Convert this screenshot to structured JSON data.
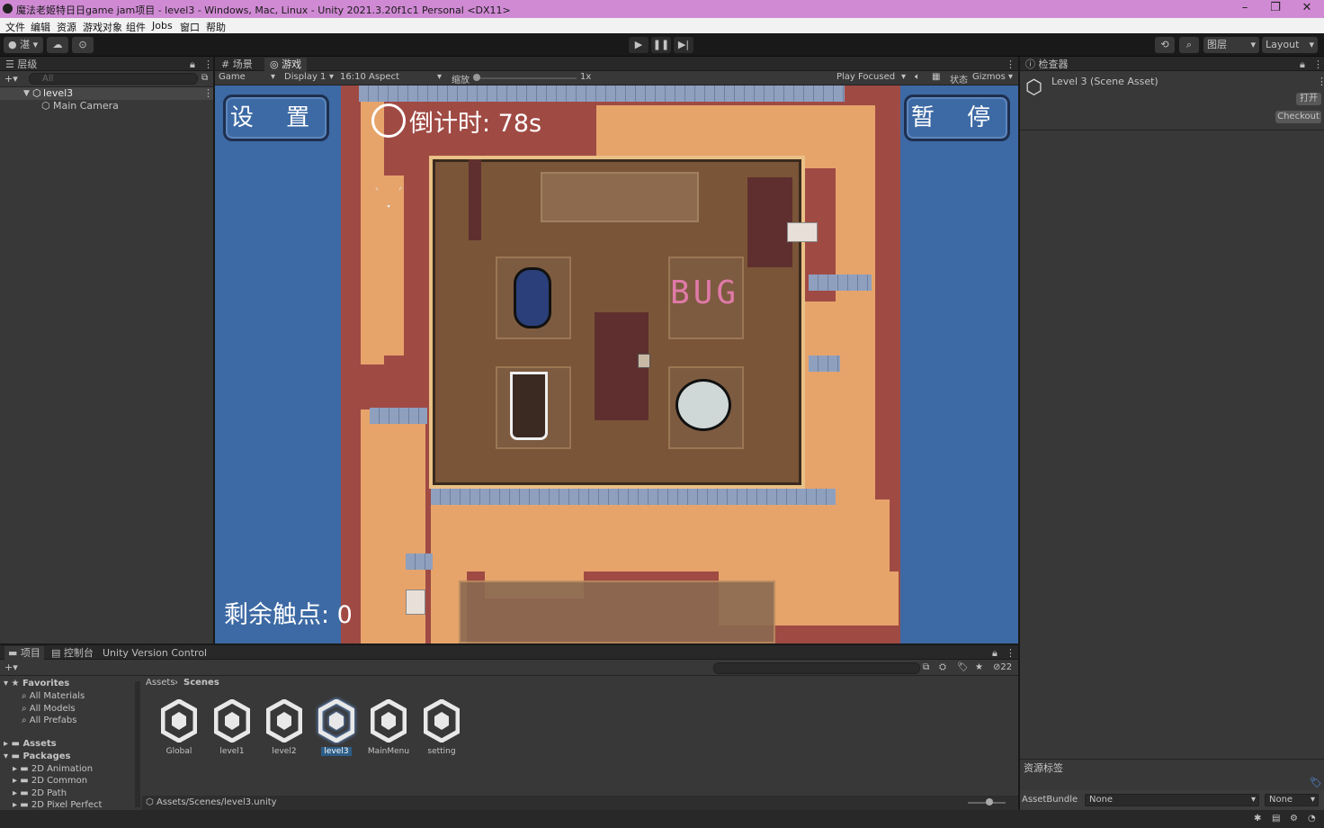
{
  "window": {
    "title": "魔法老姬特日日game jam项目 - level3 - Windows, Mac, Linux - Unity 2021.3.20f1c1 Personal <DX11>"
  },
  "menu": [
    "文件",
    "编辑",
    "资源",
    "游戏对象",
    "组件",
    "Jobs",
    "窗口",
    "帮助"
  ],
  "toolbar": {
    "account_label": "湛",
    "layers_label": "图层",
    "layout_label": "Layout"
  },
  "hierarchy": {
    "tab": "层级",
    "search_placeholder": "All",
    "scene": "level3",
    "items": [
      "Main Camera"
    ]
  },
  "game_tabs": {
    "scene": "场景",
    "game": "游戏"
  },
  "game_toolbar": {
    "mode": "Game",
    "display": "Display 1",
    "aspect": "16:10 Aspect",
    "scale_label": "缩放",
    "scale_value": "1x",
    "play_mode": "Play Focused",
    "stats": "状态",
    "gizmos": "Gizmos"
  },
  "game_ui": {
    "settings_button": "设 置",
    "timer_label": "倒计时: 78s",
    "pause_button": "暂 停",
    "remaining_label": "剩余触点: 0",
    "bug_text": "BUG"
  },
  "inspector": {
    "tab": "检查器",
    "asset_title": "Level 3 (Scene Asset)",
    "open_button": "打开",
    "checkout_button": "Checkout",
    "labels_title": "资源标签",
    "assetbundle_label": "AssetBundle",
    "assetbundle_value": "None",
    "variant_value": "None"
  },
  "project": {
    "tabs": [
      "项目",
      "控制台",
      "Unity Version Control"
    ],
    "hidden_count": "22",
    "breadcrumb": [
      "Assets",
      "Scenes"
    ],
    "favorites_title": "Favorites",
    "favorites": [
      "All Materials",
      "All Models",
      "All Prefabs"
    ],
    "assets_title": "Assets",
    "packages_title": "Packages",
    "packages": [
      "2D Animation",
      "2D Common",
      "2D Path",
      "2D Pixel Perfect"
    ],
    "scenes": [
      "Global",
      "level1",
      "level2",
      "level3",
      "MainMenu",
      "setting"
    ],
    "selected_scene": "level3",
    "path": "Assets/Scenes/level3.unity"
  }
}
